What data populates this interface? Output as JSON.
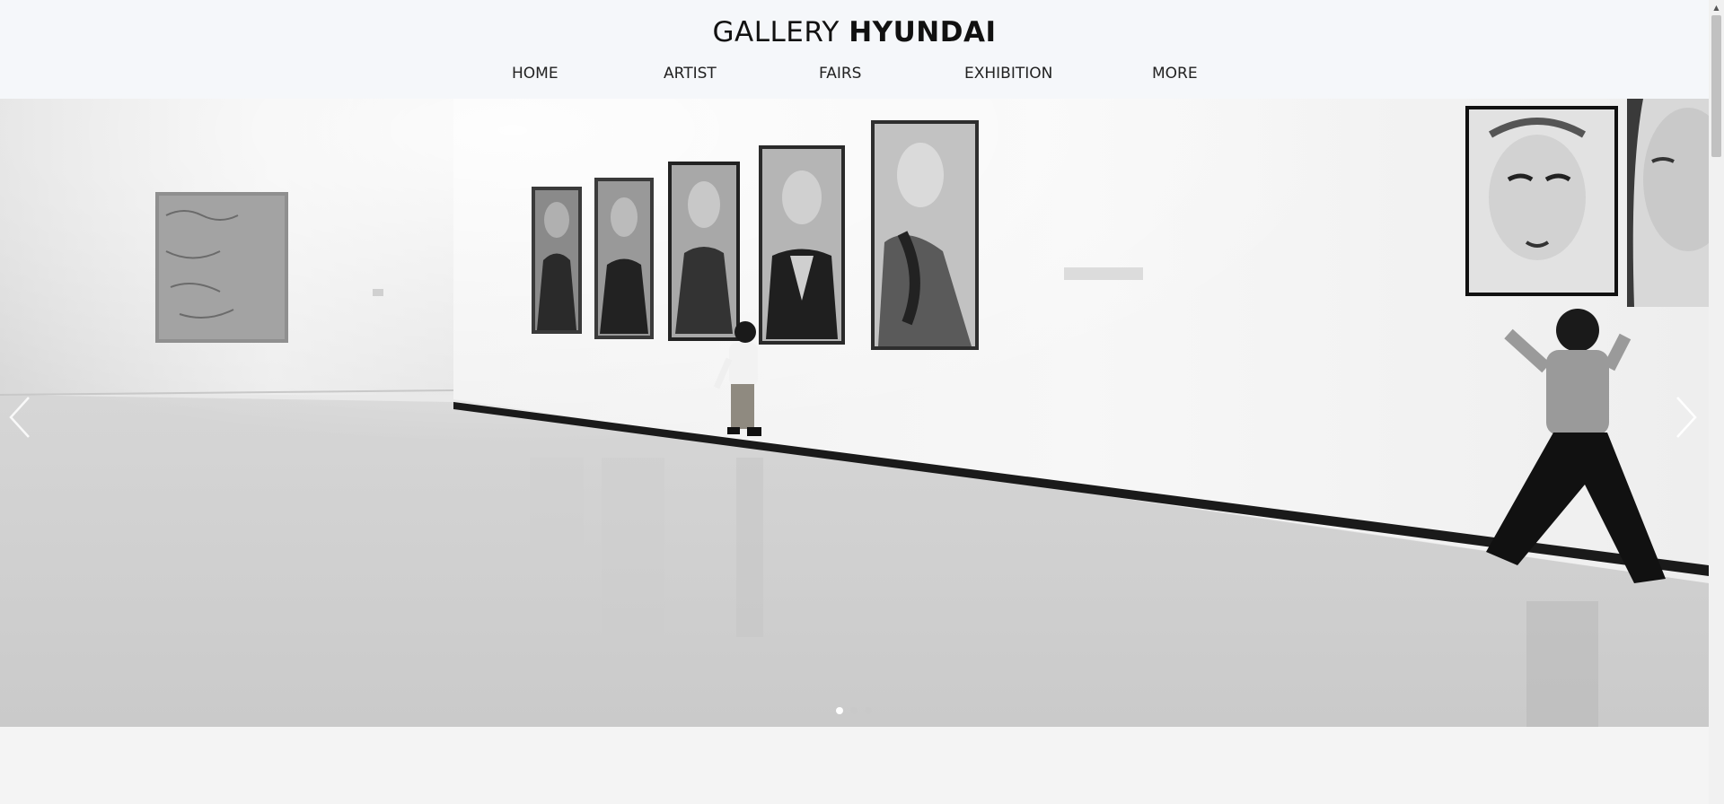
{
  "header": {
    "logo_light": "GALLERY",
    "logo_bold": "HYUNDAI"
  },
  "nav": {
    "items": [
      {
        "label": "HOME"
      },
      {
        "label": "ARTIST"
      },
      {
        "label": "FAIRS"
      },
      {
        "label": "EXHIBITION"
      },
      {
        "label": "MORE"
      }
    ]
  },
  "slider": {
    "image_icon": "gallery-photo-image",
    "prev_icon": "chevron-left-icon",
    "next_icon": "chevron-right-icon",
    "slide_count": 3,
    "active_slide": 1
  },
  "colors": {
    "header_bg": "#f5f7fa",
    "page_bg": "#f4f4f4",
    "dot_active": "#ffffff",
    "dot_inactive": "#c9c9c9"
  }
}
